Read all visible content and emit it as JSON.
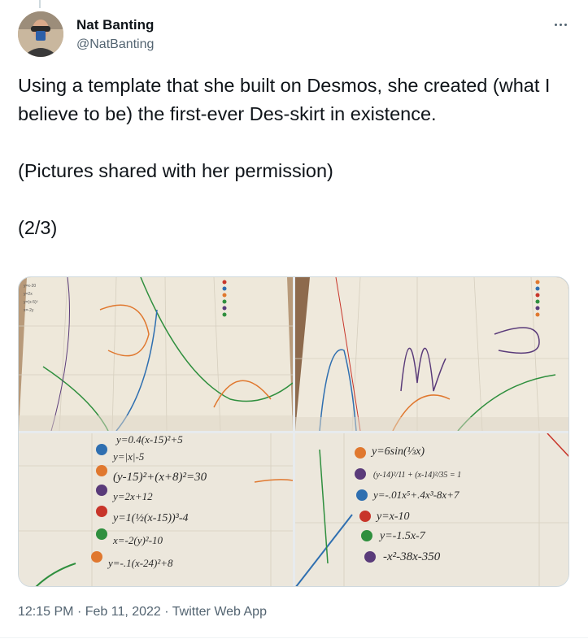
{
  "author": {
    "name": "Nat Banting",
    "handle": "@NatBanting"
  },
  "icons": {
    "more": "more-horizontal-icon"
  },
  "tweet": {
    "paragraphs": [
      "Using a template that she built on Desmos, she created (what I believe to be) the first-ever Des-skirt in existence.",
      "(Pictures shared with her permission)",
      "(2/3)"
    ],
    "time": "12:15 PM",
    "separator": "·",
    "date": "Feb 11, 2022",
    "source": "Twitter Web App"
  },
  "media": {
    "photo_bl_equations": [
      "y=0.4(x-15)²+5",
      "y=|x|-5",
      "(y-15)²+(x+8)²=30",
      "y=2x+12",
      "y=1(½(x-15))³-4",
      "x=-2(y)²-10",
      "y=-.1(x-24)²+8"
    ],
    "photo_br_equations": [
      "y=6sin(⅓x)",
      "(y-14)²/11 + (x-14)²/35 = 1",
      "y=-.01x⁵+.4x³-8x+7",
      "y=x-10",
      "y=-1.5x-7",
      "-x²-38x-350"
    ],
    "colors": {
      "fabric": "#efe9dc",
      "orange": "#e0782f",
      "green": "#2f8f3e",
      "blue": "#2f6fb0",
      "purple": "#5a3b7a",
      "red": "#c8352a"
    }
  }
}
